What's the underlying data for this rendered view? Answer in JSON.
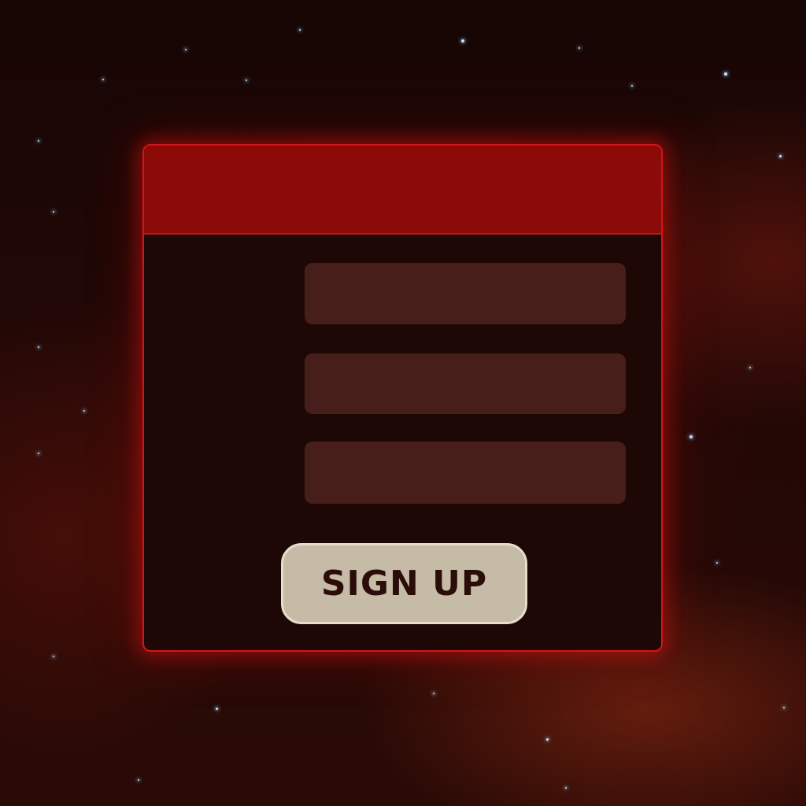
{
  "form": {
    "fields": [
      {
        "value": "",
        "placeholder": ""
      },
      {
        "value": "",
        "placeholder": ""
      },
      {
        "value": "",
        "placeholder": ""
      }
    ],
    "submit_label": "SIGN UP"
  },
  "colors": {
    "background": "#220806",
    "window_border": "#d0161a",
    "titlebar": "#8c0a07",
    "panel": "#1e0805",
    "field": "#471e19",
    "button": "#c6bba7",
    "button_text": "#2a0c08"
  }
}
